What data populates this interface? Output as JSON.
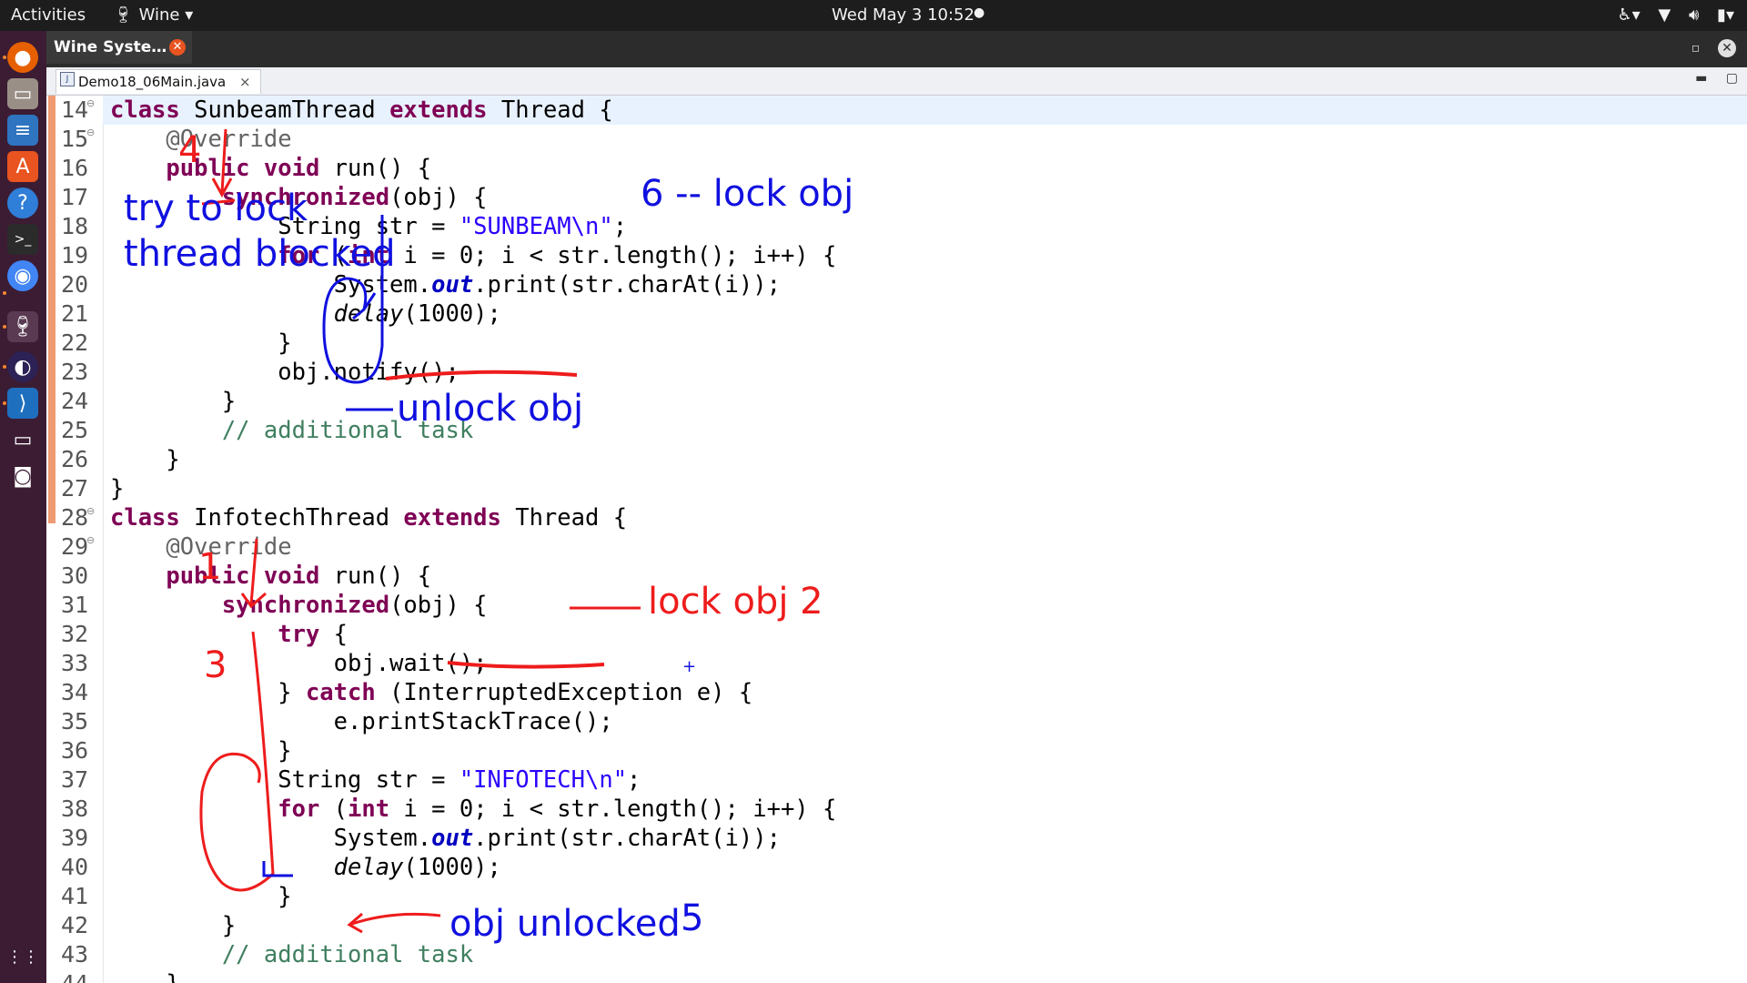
{
  "topbar": {
    "activities": "Activities",
    "wine_menu": "Wine",
    "clock": "Wed May 3  10:52",
    "status_dot": "●",
    "icons": [
      "accessibility-icon",
      "network-wifi-icon",
      "volume-icon",
      "battery-icon"
    ]
  },
  "dock": {
    "apps": [
      "firefox-icon",
      "files-icon",
      "writer-icon",
      "software-center-icon",
      "help-icon",
      "terminal-icon",
      "chrome-icon",
      "wine-icon",
      "eclipse-icon",
      "vscode-icon",
      "remote-desktop-icon",
      "screenshot-icon",
      "show-apps-icon"
    ]
  },
  "window": {
    "tab_title": "Wine Syste…",
    "close_glyph": "✕"
  },
  "editor": {
    "file_tab": "Demo18_06Main.java",
    "tab_close": "×"
  },
  "code_lines": [
    {
      "n": "14",
      "fold": "⊖",
      "html": "<span class=\"kw\">class</span> SunbeamThread <span class=\"kw\">extends</span> Thread {",
      "current": true
    },
    {
      "n": "15",
      "fold": "⊖",
      "html": "    <span class=\"ann\">@Override</span>"
    },
    {
      "n": "16",
      "fold": "",
      "html": "    <span class=\"kw\">public</span> <span class=\"kw\">void</span> run() {"
    },
    {
      "n": "17",
      "fold": "",
      "html": "        <span class=\"kw\">synchronized</span>(obj) {"
    },
    {
      "n": "18",
      "fold": "",
      "html": "            String str = <span class=\"str\">\"SUNBEAM\\n\"</span>;"
    },
    {
      "n": "19",
      "fold": "",
      "html": "            <span class=\"kw\">for</span> (<span class=\"kw\">int</span> i = 0; i &lt; str.length(); i++) {"
    },
    {
      "n": "20",
      "fold": "",
      "html": "                System.<span class=\"fld\">out</span>.print(str.charAt(i));"
    },
    {
      "n": "21",
      "fold": "",
      "html": "                <span class=\"it\">delay</span>(1000);"
    },
    {
      "n": "22",
      "fold": "",
      "html": "            }"
    },
    {
      "n": "23",
      "fold": "",
      "html": "            obj.notify();"
    },
    {
      "n": "24",
      "fold": "",
      "html": "        }"
    },
    {
      "n": "25",
      "fold": "",
      "html": "        <span class=\"cm\">// additional task</span>"
    },
    {
      "n": "26",
      "fold": "",
      "html": "    }"
    },
    {
      "n": "27",
      "fold": "",
      "html": "}"
    },
    {
      "n": "28",
      "fold": "⊖",
      "html": "<span class=\"kw\">class</span> InfotechThread <span class=\"kw\">extends</span> Thread {"
    },
    {
      "n": "29",
      "fold": "⊖",
      "html": "    <span class=\"ann\">@Override</span>"
    },
    {
      "n": "30",
      "fold": "",
      "html": "    <span class=\"kw\">public</span> <span class=\"kw\">void</span> run() {"
    },
    {
      "n": "31",
      "fold": "",
      "html": "        <span class=\"kw\">synchronized</span>(obj) {"
    },
    {
      "n": "32",
      "fold": "",
      "html": "            <span class=\"kw\">try</span> {"
    },
    {
      "n": "33",
      "fold": "",
      "html": "                obj.wait();"
    },
    {
      "n": "34",
      "fold": "",
      "html": "            } <span class=\"kw\">catch</span> (InterruptedException e) {"
    },
    {
      "n": "35",
      "fold": "",
      "html": "                e.printStackTrace();"
    },
    {
      "n": "36",
      "fold": "",
      "html": "            }"
    },
    {
      "n": "37",
      "fold": "",
      "html": "            String str = <span class=\"str\">\"INFOTECH\\n\"</span>;"
    },
    {
      "n": "38",
      "fold": "",
      "html": "            <span class=\"kw\">for</span> (<span class=\"kw\">int</span> i = 0; i &lt; str.length(); i++) {"
    },
    {
      "n": "39",
      "fold": "",
      "html": "                System.<span class=\"fld\">out</span>.print(str.charAt(i));"
    },
    {
      "n": "40",
      "fold": "",
      "html": "                <span class=\"it\">delay</span>(1000);"
    },
    {
      "n": "41",
      "fold": "",
      "html": "            }"
    },
    {
      "n": "42",
      "fold": "",
      "html": "        }"
    },
    {
      "n": "43",
      "fold": "",
      "html": "        <span class=\"cm\">// additional task</span>"
    },
    {
      "n": "44",
      "fold": "",
      "html": "    }"
    }
  ],
  "annotations": {
    "step4": "4",
    "try_to_lock": "try to lock",
    "thread_blocked": "thread blocked",
    "lock_obj_6": "6 -- lock obj",
    "unlock_obj": "unlock obj",
    "step1": "1",
    "lock_obj_2": "lock obj 2",
    "step3": "3",
    "obj_unlocked": "obj unlocked",
    "step5": "5",
    "cursor": "+"
  },
  "colors": {
    "ink_red": "#ee1c1c",
    "ink_blue": "#1010e0",
    "dock_bg": "#3b1c33",
    "keyword": "#7f0055"
  }
}
